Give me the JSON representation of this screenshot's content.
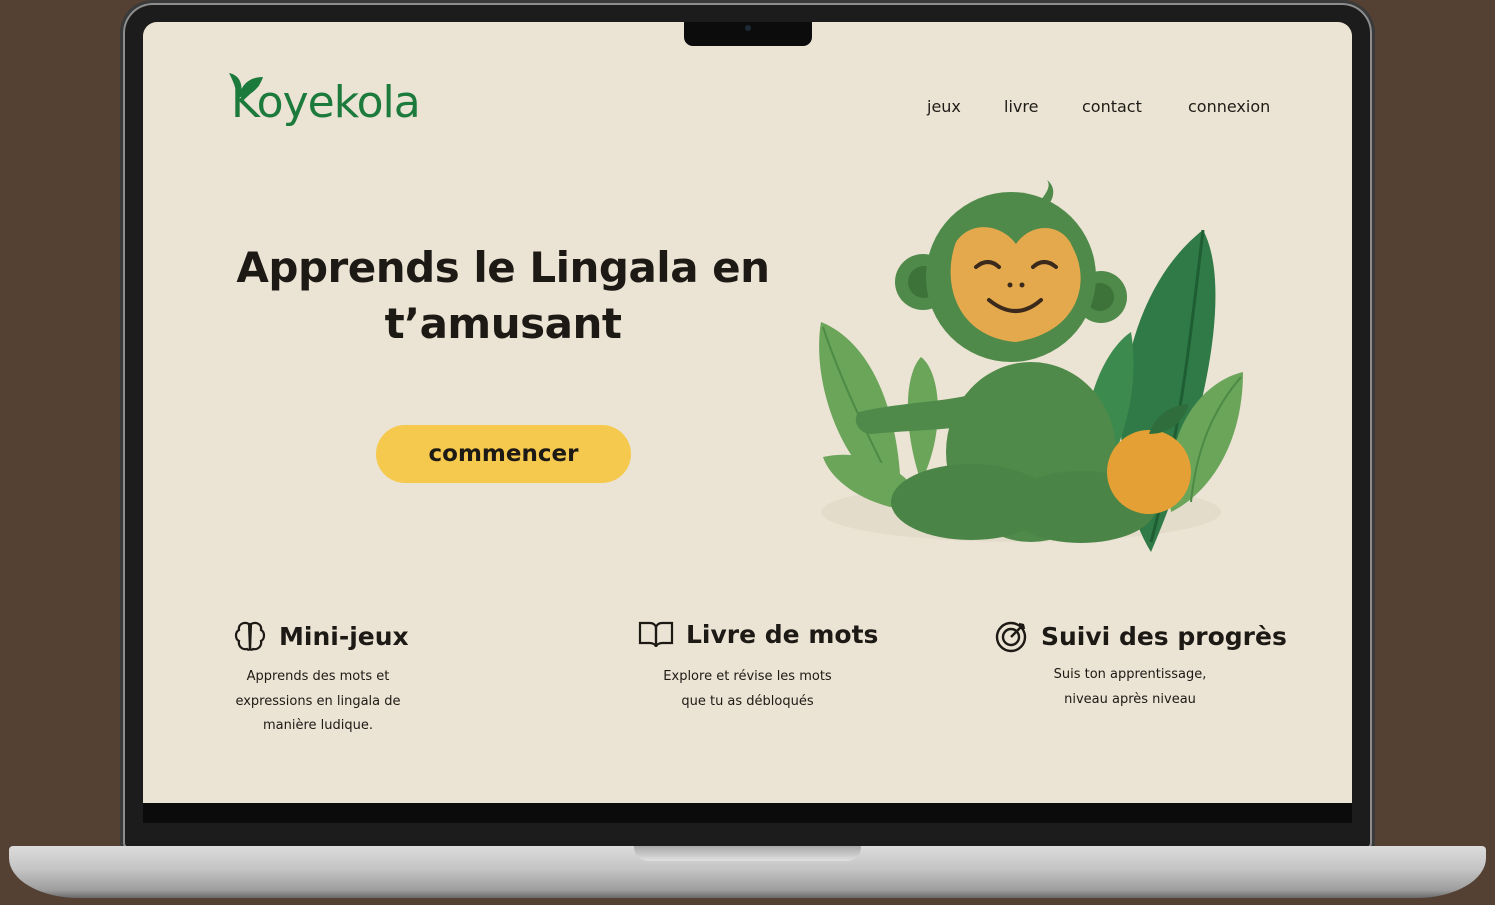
{
  "brand": {
    "name": "Koyekola",
    "color": "#1c7a3d"
  },
  "nav": {
    "games": "jeux",
    "book": "livre",
    "contact": "contact",
    "login": "connexion"
  },
  "hero": {
    "title_line1": "Apprends le Lingala en",
    "title_line2": "t’amusant",
    "cta": "commencer",
    "cta_color": "#f5c94d"
  },
  "features": [
    {
      "icon": "brain-icon",
      "title": "Mini-jeux",
      "desc_lines": [
        "Apprends des mots et",
        "expressions en lingala de",
        "manière ludique."
      ]
    },
    {
      "icon": "open-book-icon",
      "title": "Livre de mots",
      "desc_lines": [
        "Explore et révise les mots",
        "que tu as débloqués"
      ]
    },
    {
      "icon": "target-icon",
      "title": "Suivi des progrès",
      "desc_lines": [
        "Suis ton apprentissage,",
        "niveau après niveau"
      ]
    }
  ],
  "colors": {
    "background": "#ebe3d3",
    "monkey": "#4f8a4a",
    "monkey_face": "#e3a94c",
    "orange": "#e4a035"
  }
}
